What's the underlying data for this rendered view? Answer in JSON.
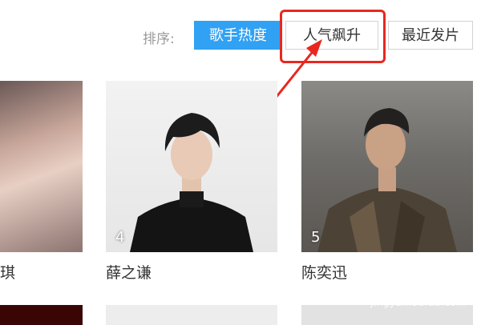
{
  "sort": {
    "label": "排序:",
    "options": [
      {
        "label": "歌手热度",
        "active": true
      },
      {
        "label": "人气飙升",
        "active": false
      },
      {
        "label": "最近发片",
        "active": false
      }
    ]
  },
  "colors": {
    "accent": "#31a1f3",
    "annotation": "#e8281f"
  },
  "cards": [
    {
      "name": "琪",
      "rank": ""
    },
    {
      "name": "薛之谦",
      "rank": "4"
    },
    {
      "name": "陈奕迅",
      "rank": "5"
    }
  ],
  "watermark": {
    "logo": "Bai 度",
    "text": "经验",
    "url": "jingyan.baidu.com"
  }
}
